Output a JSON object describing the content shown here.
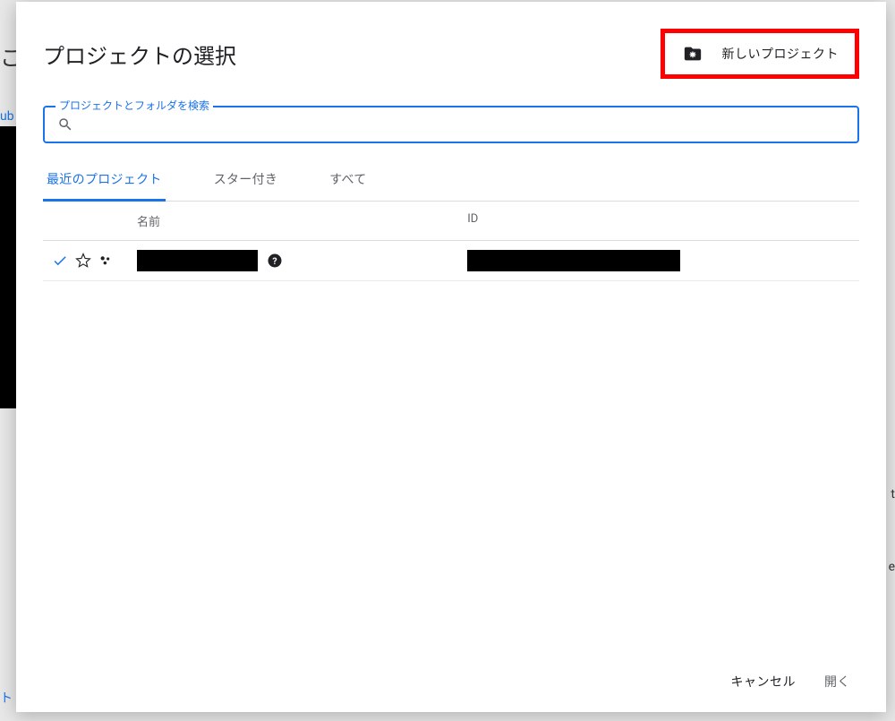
{
  "backdrop": {
    "top_char": "こ",
    "ub": "ub",
    "t": "t",
    "e": "e",
    "bottom": "ト"
  },
  "modal": {
    "title": "プロジェクトの選択",
    "new_project_label": "新しいプロジェクト"
  },
  "search": {
    "label": "プロジェクトとフォルダを検索",
    "placeholder": ""
  },
  "tabs": {
    "recent": "最近のプロジェクト",
    "starred": "スター付き",
    "all": "すべて"
  },
  "table": {
    "headers": {
      "name": "名前",
      "id": "ID"
    }
  },
  "footer": {
    "cancel": "キャンセル",
    "open": "開く"
  }
}
